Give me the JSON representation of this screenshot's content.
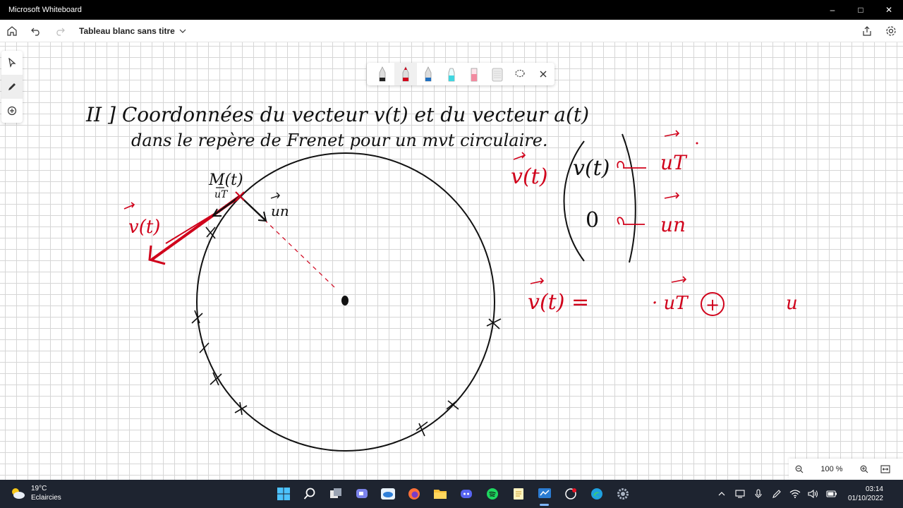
{
  "window": {
    "title": "Microsoft Whiteboard",
    "minimize": "–",
    "maximize": "□",
    "close": "✕"
  },
  "appbar": {
    "doc_title": "Tableau blanc sans titre"
  },
  "pen_tray": {
    "pens": [
      "#222222",
      "#d0021b",
      "#1f6fbf",
      "#3fd6e0",
      "#f28aa0",
      "#c8c8c8"
    ],
    "active_pen": 1
  },
  "zoom": {
    "level": "100 %"
  },
  "board": {
    "heading_line1": "II ] Coordonnées du vecteur v(t) et du vecteur a(t)",
    "heading_line2": "dans le repère de Frenet pour un mvt circulaire.",
    "point_label": "M(t)",
    "label_ut": "uT",
    "label_un": "un",
    "label_vt": "v(t)",
    "matrix_lhs": "v(t)",
    "matrix_row1": "v(t)",
    "matrix_row2": "0",
    "matrix_basis1": "uT",
    "matrix_basis2": "un",
    "equation_lhs": "v(t) =",
    "equation_mid": "· uT",
    "equation_plus": "+",
    "equation_tail": "u",
    "ink_black": "#111111",
    "ink_red": "#d0021b"
  },
  "taskbar": {
    "temperature": "19°C",
    "weather_text": "Eclaircies",
    "time": "03:14",
    "date": "01/10/2022"
  }
}
